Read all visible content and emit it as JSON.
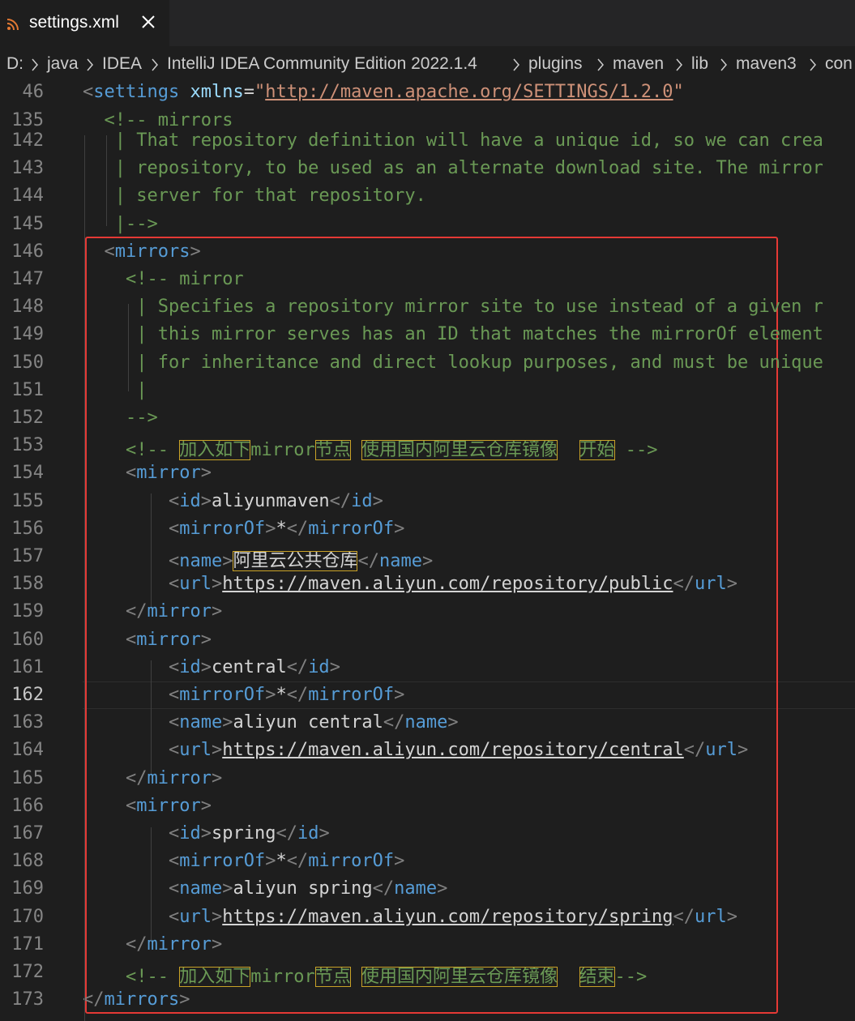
{
  "tab": {
    "title": "settings.xml",
    "icon": "rss-feed-icon",
    "close_glyph": "✕"
  },
  "breadcrumb": [
    "D:",
    "java",
    "IDEA",
    "IntelliJ IDEA Community Edition 2022.1.4",
    "plugins",
    "maven",
    "lib",
    "maven3",
    "con"
  ],
  "editor": {
    "active_line": "162",
    "lines": [
      {
        "n": "46",
        "parts": [
          [
            "gray",
            "<"
          ],
          [
            "tag",
            "settings"
          ],
          [
            "txt",
            " "
          ],
          [
            "attr",
            "xmlns"
          ],
          [
            "txt",
            "="
          ],
          [
            "str-q",
            "\""
          ],
          [
            "str",
            "http://maven.apache.org/SETTINGS/1.2.0"
          ],
          [
            "str-q",
            "\""
          ]
        ]
      },
      {
        "n": "135",
        "parts": [
          [
            "txt",
            "  "
          ],
          [
            "cm",
            "<!-- mirrors"
          ]
        ]
      },
      {
        "n": "142",
        "parts": [
          [
            "txt",
            "   "
          ],
          [
            "cm",
            "| That repository definition will have a unique id, so we can crea"
          ]
        ]
      },
      {
        "n": "143",
        "parts": [
          [
            "txt",
            "   "
          ],
          [
            "cm",
            "| repository, to be used as an alternate download site. The mirror"
          ]
        ]
      },
      {
        "n": "144",
        "parts": [
          [
            "txt",
            "   "
          ],
          [
            "cm",
            "| server for that repository."
          ]
        ]
      },
      {
        "n": "145",
        "parts": [
          [
            "txt",
            "   "
          ],
          [
            "cm",
            "|-->"
          ]
        ]
      },
      {
        "n": "146",
        "parts": [
          [
            "txt",
            "  "
          ],
          [
            "gray",
            "<"
          ],
          [
            "tag",
            "mirrors"
          ],
          [
            "gray",
            ">"
          ]
        ]
      },
      {
        "n": "147",
        "parts": [
          [
            "txt",
            "    "
          ],
          [
            "cm",
            "<!-- mirror"
          ]
        ]
      },
      {
        "n": "148",
        "parts": [
          [
            "txt",
            "     "
          ],
          [
            "cm",
            "| Specifies a repository mirror site to use instead of a given r"
          ]
        ]
      },
      {
        "n": "149",
        "parts": [
          [
            "txt",
            "     "
          ],
          [
            "cm",
            "| this mirror serves has an ID that matches the mirrorOf element"
          ]
        ]
      },
      {
        "n": "150",
        "parts": [
          [
            "txt",
            "     "
          ],
          [
            "cm",
            "| for inheritance and direct lookup purposes, and must be unique"
          ]
        ]
      },
      {
        "n": "151",
        "parts": [
          [
            "txt",
            "     "
          ],
          [
            "cm",
            "|"
          ]
        ]
      },
      {
        "n": "152",
        "parts": [
          [
            "txt",
            "    "
          ],
          [
            "cm",
            "-->"
          ]
        ]
      },
      {
        "n": "153",
        "parts": [
          [
            "txt",
            "    "
          ],
          [
            "cm",
            "<!-- "
          ],
          [
            "cmhl",
            "加入如下"
          ],
          [
            "cm",
            "mirror"
          ],
          [
            "cmhl",
            "节点"
          ],
          [
            "cm",
            " "
          ],
          [
            "cmhl",
            "使用国内阿里云仓库镜像"
          ],
          [
            "cm",
            "  "
          ],
          [
            "cmhl",
            "开始"
          ],
          [
            "cm",
            " -->"
          ]
        ]
      },
      {
        "n": "154",
        "parts": [
          [
            "txt",
            "    "
          ],
          [
            "gray",
            "<"
          ],
          [
            "tag",
            "mirror"
          ],
          [
            "gray",
            ">"
          ]
        ]
      },
      {
        "n": "155",
        "parts": [
          [
            "txt",
            "        "
          ],
          [
            "gray",
            "<"
          ],
          [
            "tag",
            "id"
          ],
          [
            "gray",
            ">"
          ],
          [
            "txt",
            "aliyunmaven"
          ],
          [
            "gray",
            "</"
          ],
          [
            "tag",
            "id"
          ],
          [
            "gray",
            ">"
          ]
        ]
      },
      {
        "n": "156",
        "parts": [
          [
            "txt",
            "        "
          ],
          [
            "gray",
            "<"
          ],
          [
            "tag",
            "mirrorOf"
          ],
          [
            "gray",
            ">"
          ],
          [
            "txt",
            "*"
          ],
          [
            "gray",
            "</"
          ],
          [
            "tag",
            "mirrorOf"
          ],
          [
            "gray",
            ">"
          ]
        ]
      },
      {
        "n": "157",
        "parts": [
          [
            "txt",
            "        "
          ],
          [
            "gray",
            "<"
          ],
          [
            "tag",
            "name"
          ],
          [
            "gray",
            ">"
          ],
          [
            "txthl",
            "阿里云公共仓库"
          ],
          [
            "gray",
            "</"
          ],
          [
            "tag",
            "name"
          ],
          [
            "gray",
            ">"
          ]
        ]
      },
      {
        "n": "158",
        "parts": [
          [
            "txt",
            "        "
          ],
          [
            "gray",
            "<"
          ],
          [
            "tag",
            "url"
          ],
          [
            "gray",
            ">"
          ],
          [
            "url",
            "https://maven.aliyun.com/repository/public"
          ],
          [
            "gray",
            "</"
          ],
          [
            "tag",
            "url"
          ],
          [
            "gray",
            ">"
          ]
        ]
      },
      {
        "n": "159",
        "parts": [
          [
            "txt",
            "    "
          ],
          [
            "gray",
            "</"
          ],
          [
            "tag",
            "mirror"
          ],
          [
            "gray",
            ">"
          ]
        ]
      },
      {
        "n": "160",
        "parts": [
          [
            "txt",
            "    "
          ],
          [
            "gray",
            "<"
          ],
          [
            "tag",
            "mirror"
          ],
          [
            "gray",
            ">"
          ]
        ]
      },
      {
        "n": "161",
        "parts": [
          [
            "txt",
            "        "
          ],
          [
            "gray",
            "<"
          ],
          [
            "tag",
            "id"
          ],
          [
            "gray",
            ">"
          ],
          [
            "txt",
            "central"
          ],
          [
            "gray",
            "</"
          ],
          [
            "tag",
            "id"
          ],
          [
            "gray",
            ">"
          ]
        ]
      },
      {
        "n": "162",
        "parts": [
          [
            "txt",
            "        "
          ],
          [
            "gray",
            "<"
          ],
          [
            "tag",
            "mirrorOf"
          ],
          [
            "gray",
            ">"
          ],
          [
            "txt",
            "*"
          ],
          [
            "gray",
            "</"
          ],
          [
            "tag",
            "mirrorOf"
          ],
          [
            "gray",
            ">"
          ]
        ]
      },
      {
        "n": "163",
        "parts": [
          [
            "txt",
            "        "
          ],
          [
            "gray",
            "<"
          ],
          [
            "tag",
            "name"
          ],
          [
            "gray",
            ">"
          ],
          [
            "txt",
            "aliyun central"
          ],
          [
            "gray",
            "</"
          ],
          [
            "tag",
            "name"
          ],
          [
            "gray",
            ">"
          ]
        ]
      },
      {
        "n": "164",
        "parts": [
          [
            "txt",
            "        "
          ],
          [
            "gray",
            "<"
          ],
          [
            "tag",
            "url"
          ],
          [
            "gray",
            ">"
          ],
          [
            "url",
            "https://maven.aliyun.com/repository/central"
          ],
          [
            "gray",
            "</"
          ],
          [
            "tag",
            "url"
          ],
          [
            "gray",
            ">"
          ]
        ]
      },
      {
        "n": "165",
        "parts": [
          [
            "txt",
            "    "
          ],
          [
            "gray",
            "</"
          ],
          [
            "tag",
            "mirror"
          ],
          [
            "gray",
            ">"
          ]
        ]
      },
      {
        "n": "166",
        "parts": [
          [
            "txt",
            "    "
          ],
          [
            "gray",
            "<"
          ],
          [
            "tag",
            "mirror"
          ],
          [
            "gray",
            ">"
          ]
        ]
      },
      {
        "n": "167",
        "parts": [
          [
            "txt",
            "        "
          ],
          [
            "gray",
            "<"
          ],
          [
            "tag",
            "id"
          ],
          [
            "gray",
            ">"
          ],
          [
            "txt",
            "spring"
          ],
          [
            "gray",
            "</"
          ],
          [
            "tag",
            "id"
          ],
          [
            "gray",
            ">"
          ]
        ]
      },
      {
        "n": "168",
        "parts": [
          [
            "txt",
            "        "
          ],
          [
            "gray",
            "<"
          ],
          [
            "tag",
            "mirrorOf"
          ],
          [
            "gray",
            ">"
          ],
          [
            "txt",
            "*"
          ],
          [
            "gray",
            "</"
          ],
          [
            "tag",
            "mirrorOf"
          ],
          [
            "gray",
            ">"
          ]
        ]
      },
      {
        "n": "169",
        "parts": [
          [
            "txt",
            "        "
          ],
          [
            "gray",
            "<"
          ],
          [
            "tag",
            "name"
          ],
          [
            "gray",
            ">"
          ],
          [
            "txt",
            "aliyun spring"
          ],
          [
            "gray",
            "</"
          ],
          [
            "tag",
            "name"
          ],
          [
            "gray",
            ">"
          ]
        ]
      },
      {
        "n": "170",
        "parts": [
          [
            "txt",
            "        "
          ],
          [
            "gray",
            "<"
          ],
          [
            "tag",
            "url"
          ],
          [
            "gray",
            ">"
          ],
          [
            "url",
            "https://maven.aliyun.com/repository/spring"
          ],
          [
            "gray",
            "</"
          ],
          [
            "tag",
            "url"
          ],
          [
            "gray",
            ">"
          ]
        ]
      },
      {
        "n": "171",
        "parts": [
          [
            "txt",
            "    "
          ],
          [
            "gray",
            "</"
          ],
          [
            "tag",
            "mirror"
          ],
          [
            "gray",
            ">"
          ]
        ]
      },
      {
        "n": "172",
        "parts": [
          [
            "txt",
            "    "
          ],
          [
            "cm",
            "<!-- "
          ],
          [
            "cmhl",
            "加入如下"
          ],
          [
            "cm",
            "mirror"
          ],
          [
            "cmhl",
            "节点"
          ],
          [
            "cm",
            " "
          ],
          [
            "cmhl",
            "使用国内阿里云仓库镜像"
          ],
          [
            "cm",
            "  "
          ],
          [
            "cmhl",
            "结束"
          ],
          [
            "cm",
            "-->"
          ]
        ]
      },
      {
        "n": "173",
        "parts": [
          [
            "gray",
            "</"
          ],
          [
            "tag",
            "mirrors"
          ],
          [
            "gray",
            ">"
          ]
        ]
      }
    ]
  },
  "colors": {
    "background": "#1e1e1e",
    "tag": "#569cd6",
    "comment": "#6a9955",
    "string": "#ce9178",
    "attribute": "#9cdcfe",
    "annotation_box": "#e53935"
  }
}
